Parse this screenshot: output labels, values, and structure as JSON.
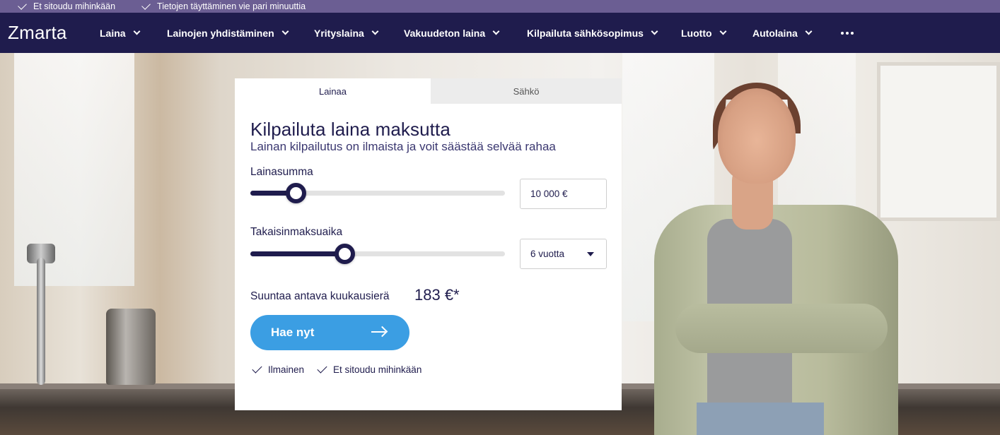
{
  "topbar": {
    "items": [
      "Et sitoudu mihinkään",
      "Tietojen täyttäminen vie pari minuuttia"
    ]
  },
  "nav": {
    "logo": "Zmarta",
    "items": [
      "Laina",
      "Lainojen yhdistäminen",
      "Yrityslaina",
      "Vakuudeton laina",
      "Kilpailuta sähkösopimus",
      "Luotto",
      "Autolaina"
    ]
  },
  "form": {
    "tabs": [
      "Lainaa",
      "Sähkö"
    ],
    "active_tab": "Lainaa",
    "title": "Kilpailuta laina maksutta",
    "subtitle": "Lainan kilpailutus on ilmaista ja voit säästää selvää rahaa",
    "loan_amount": {
      "label": "Lainasumma",
      "value": "10 000 €",
      "slider_fraction": 0.18
    },
    "repayment": {
      "label": "Takaisinmaksuaika",
      "value": "6 vuotta",
      "slider_fraction": 0.37
    },
    "monthly": {
      "label": "Suuntaa antava kuukausierä",
      "value": "183 €*"
    },
    "cta_label": "Hae nyt",
    "benefits": [
      "Ilmainen",
      "Et sitoudu mihinkään"
    ]
  },
  "colors": {
    "navy": "#1f1c4d",
    "topbar": "#6b5e93",
    "cta": "#3b9ee3"
  }
}
